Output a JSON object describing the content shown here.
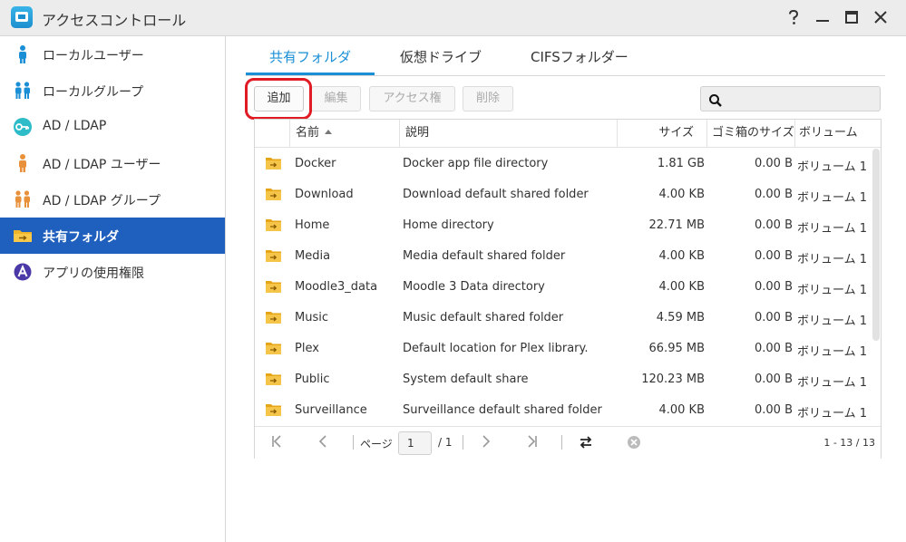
{
  "window": {
    "title": "アクセスコントロール",
    "controls": {
      "help": "?",
      "minimize": "minimize",
      "maximize": "maximize",
      "close": "close"
    }
  },
  "sidebar": {
    "items": [
      {
        "label": "ローカルユーザー",
        "icon": "user-icon",
        "active": false
      },
      {
        "label": "ローカルグループ",
        "icon": "group-icon",
        "active": false
      },
      {
        "label": "AD / LDAP",
        "icon": "key-icon",
        "active": false
      },
      {
        "label": "AD / LDAP ユーザー",
        "icon": "ad-user-icon",
        "active": false
      },
      {
        "label": "AD / LDAP グループ",
        "icon": "ad-group-icon",
        "active": false
      },
      {
        "label": "共有フォルダ",
        "icon": "shared-folder-icon",
        "active": true
      },
      {
        "label": "アプリの使用権限",
        "icon": "app-permission-icon",
        "active": false
      }
    ]
  },
  "tabs": [
    {
      "label": "共有フォルダ",
      "active": true
    },
    {
      "label": "仮想ドライブ",
      "active": false
    },
    {
      "label": "CIFSフォルダー",
      "active": false
    }
  ],
  "toolbar": {
    "add": "追加",
    "edit": "編集",
    "access": "アクセス権",
    "delete": "削除",
    "search_placeholder": ""
  },
  "table": {
    "headers": {
      "name": "名前",
      "description": "説明",
      "size": "サイズ",
      "trash_size": "ゴミ箱のサイズ",
      "volume": "ボリューム"
    },
    "rows": [
      {
        "name": "Docker",
        "description": "Docker app file directory",
        "size": "1.81 GB",
        "trash": "0.00 B",
        "volume": "ボリューム 1"
      },
      {
        "name": "Download",
        "description": "Download default shared folder",
        "size": "4.00 KB",
        "trash": "0.00 B",
        "volume": "ボリューム 1"
      },
      {
        "name": "Home",
        "description": "Home directory",
        "size": "22.71 MB",
        "trash": "0.00 B",
        "volume": "ボリューム 1"
      },
      {
        "name": "Media",
        "description": "Media default shared folder",
        "size": "4.00 KB",
        "trash": "0.00 B",
        "volume": "ボリューム 1"
      },
      {
        "name": "Moodle3_data",
        "description": "Moodle 3 Data directory",
        "size": "4.00 KB",
        "trash": "0.00 B",
        "volume": "ボリューム 1"
      },
      {
        "name": "Music",
        "description": "Music default shared folder",
        "size": "4.59 MB",
        "trash": "0.00 B",
        "volume": "ボリューム 1"
      },
      {
        "name": "Plex",
        "description": "Default location for Plex library.",
        "size": "66.95 MB",
        "trash": "0.00 B",
        "volume": "ボリューム 1"
      },
      {
        "name": "Public",
        "description": "System default share",
        "size": "120.23 MB",
        "trash": "0.00 B",
        "volume": "ボリューム 1"
      },
      {
        "name": "Surveillance",
        "description": "Surveillance default shared folder",
        "size": "4.00 KB",
        "trash": "0.00 B",
        "volume": "ボリューム 1"
      }
    ]
  },
  "pager": {
    "page_label": "ページ",
    "page_value": "1",
    "page_total": "/ 1",
    "count": "1 - 13 / 13"
  },
  "colors": {
    "accent": "#1a8fd6",
    "sidebar_active": "#1f5fbd",
    "highlight": "#e01b24",
    "folder": "#f0b429"
  }
}
